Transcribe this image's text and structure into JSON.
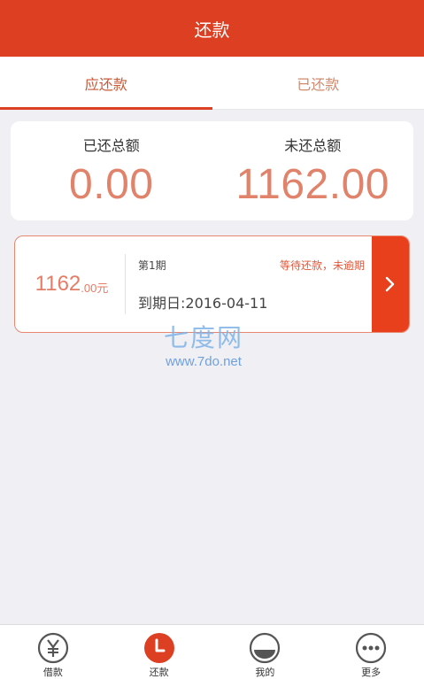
{
  "header": {
    "title": "还款"
  },
  "tabs": [
    {
      "label": "应还款"
    },
    {
      "label": "已还款"
    }
  ],
  "summary": {
    "paid_label": "已还总额",
    "paid_value": "0.00",
    "unpaid_label": "未还总额",
    "unpaid_value": "1162.00"
  },
  "bill": {
    "amount_int": "1162",
    "amount_dec": ".00元",
    "period": "第1期",
    "status": "等待还款，未逾期",
    "due": "到期日:2016-04-11"
  },
  "watermark": {
    "cn": "七度网",
    "url": "www.7do.net"
  },
  "tabbar": [
    {
      "label": "借款",
      "icon": "yen-icon"
    },
    {
      "label": "还款",
      "icon": "clock-icon"
    },
    {
      "label": "我的",
      "icon": "profile-icon"
    },
    {
      "label": "更多",
      "icon": "more-icon"
    }
  ],
  "colors": {
    "brand": "#dd3f22",
    "amount": "#e1826b",
    "arrow_bg": "#e8401d"
  }
}
